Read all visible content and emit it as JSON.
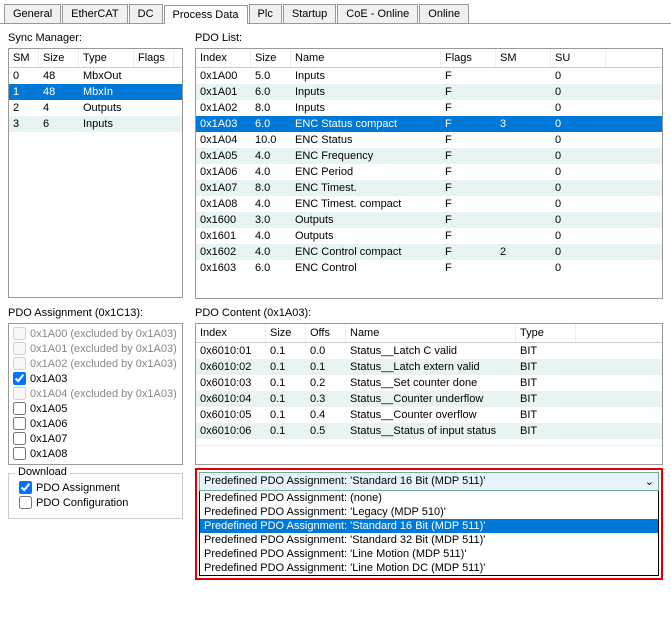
{
  "tabs": [
    "General",
    "EtherCAT",
    "DC",
    "Process Data",
    "Plc",
    "Startup",
    "CoE - Online",
    "Online"
  ],
  "active_tab": 3,
  "sync_mgr": {
    "label": "Sync Manager:",
    "cols": [
      "SM",
      "Size",
      "Type",
      "Flags"
    ],
    "rows": [
      [
        "0",
        "48",
        "MbxOut",
        ""
      ],
      [
        "1",
        "48",
        "MbxIn",
        ""
      ],
      [
        "2",
        "4",
        "Outputs",
        ""
      ],
      [
        "3",
        "6",
        "Inputs",
        ""
      ]
    ],
    "selected": 1
  },
  "pdo_list": {
    "label": "PDO List:",
    "cols": [
      "Index",
      "Size",
      "Name",
      "Flags",
      "SM",
      "SU"
    ],
    "rows": [
      [
        "0x1A00",
        "5.0",
        "Inputs",
        "F",
        "",
        "0"
      ],
      [
        "0x1A01",
        "6.0",
        "Inputs",
        "F",
        "",
        "0"
      ],
      [
        "0x1A02",
        "8.0",
        "Inputs",
        "F",
        "",
        "0"
      ],
      [
        "0x1A03",
        "6.0",
        "ENC Status compact",
        "F",
        "3",
        "0"
      ],
      [
        "0x1A04",
        "10.0",
        "ENC Status",
        "F",
        "",
        "0"
      ],
      [
        "0x1A05",
        "4.0",
        "ENC Frequency",
        "F",
        "",
        "0"
      ],
      [
        "0x1A06",
        "4.0",
        "ENC Period",
        "F",
        "",
        "0"
      ],
      [
        "0x1A07",
        "8.0",
        "ENC Timest.",
        "F",
        "",
        "0"
      ],
      [
        "0x1A08",
        "4.0",
        "ENC Timest. compact",
        "F",
        "",
        "0"
      ],
      [
        "0x1600",
        "3.0",
        "Outputs",
        "F",
        "",
        "0"
      ],
      [
        "0x1601",
        "4.0",
        "Outputs",
        "F",
        "",
        "0"
      ],
      [
        "0x1602",
        "4.0",
        "ENC Control compact",
        "F",
        "2",
        "0"
      ],
      [
        "0x1603",
        "6.0",
        "ENC Control",
        "F",
        "",
        "0"
      ]
    ],
    "selected": 3
  },
  "pdo_assign": {
    "label": "PDO Assignment (0x1C13):",
    "items": [
      {
        "label": "0x1A00 (excluded by 0x1A03)",
        "checked": false,
        "disabled": true
      },
      {
        "label": "0x1A01 (excluded by 0x1A03)",
        "checked": false,
        "disabled": true
      },
      {
        "label": "0x1A02 (excluded by 0x1A03)",
        "checked": false,
        "disabled": true
      },
      {
        "label": "0x1A03",
        "checked": true,
        "disabled": false
      },
      {
        "label": "0x1A04 (excluded by 0x1A03)",
        "checked": false,
        "disabled": true
      },
      {
        "label": "0x1A05",
        "checked": false,
        "disabled": false
      },
      {
        "label": "0x1A06",
        "checked": false,
        "disabled": false
      },
      {
        "label": "0x1A07",
        "checked": false,
        "disabled": false
      },
      {
        "label": "0x1A08",
        "checked": false,
        "disabled": false
      }
    ]
  },
  "pdo_content": {
    "label": "PDO Content (0x1A03):",
    "cols": [
      "Index",
      "Size",
      "Offs",
      "Name",
      "Type"
    ],
    "rows": [
      [
        "0x6010:01",
        "0.1",
        "0.0",
        "Status__Latch C valid",
        "BIT"
      ],
      [
        "0x6010:02",
        "0.1",
        "0.1",
        "Status__Latch extern valid",
        "BIT"
      ],
      [
        "0x6010:03",
        "0.1",
        "0.2",
        "Status__Set counter done",
        "BIT"
      ],
      [
        "0x6010:04",
        "0.1",
        "0.3",
        "Status__Counter underflow",
        "BIT"
      ],
      [
        "0x6010:05",
        "0.1",
        "0.4",
        "Status__Counter overflow",
        "BIT"
      ],
      [
        "0x6010:06",
        "0.1",
        "0.5",
        "Status__Status of input status",
        "BIT"
      ]
    ]
  },
  "download": {
    "legend": "Download",
    "items": [
      {
        "label": "PDO Assignment",
        "checked": true
      },
      {
        "label": "PDO Configuration",
        "checked": false
      }
    ]
  },
  "predefined": {
    "selected_text": "Predefined PDO Assignment: 'Standard 16 Bit (MDP 511)'",
    "options": [
      "Predefined PDO Assignment: (none)",
      "Predefined PDO Assignment: 'Legacy (MDP 510)'",
      "Predefined PDO Assignment: 'Standard 16 Bit (MDP 511)'",
      "Predefined PDO Assignment: 'Standard 32 Bit (MDP 511)'",
      "Predefined PDO Assignment: 'Line Motion (MDP 511)'",
      "Predefined PDO Assignment: 'Line Motion DC (MDP 511)'"
    ],
    "selected_index": 2
  }
}
